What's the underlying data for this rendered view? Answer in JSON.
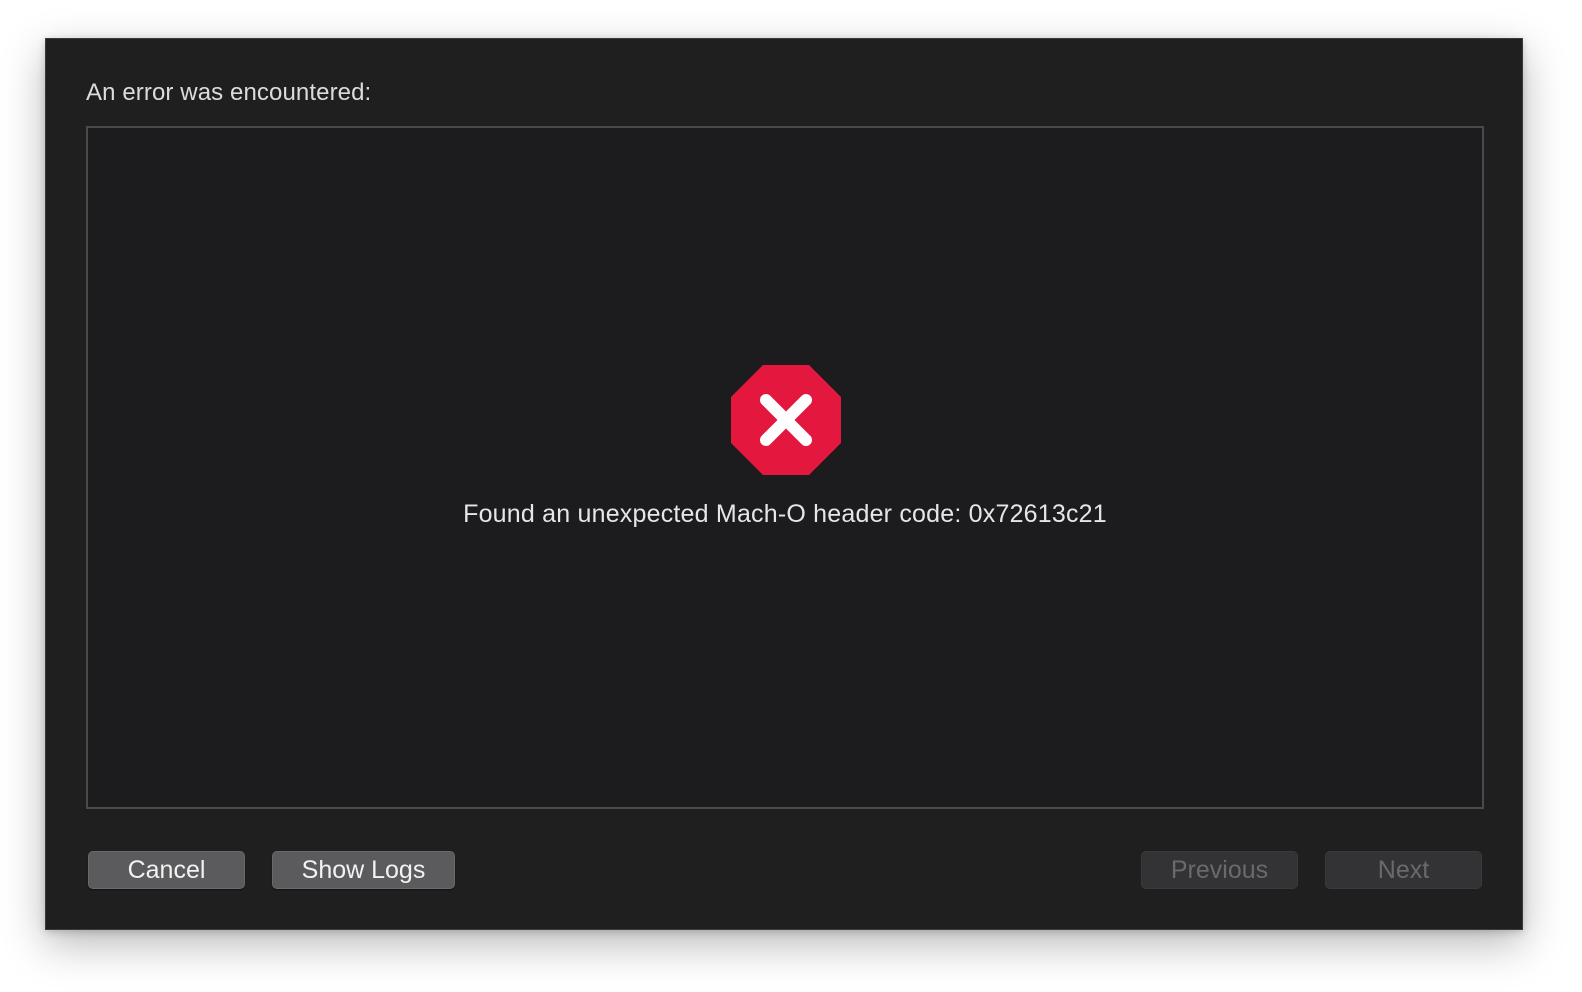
{
  "dialog": {
    "heading": "An error was encountered:",
    "error_message": "Found an unexpected Mach-O header code: 0x72613c21",
    "icon": "error-stop-icon",
    "icon_color": "#e4173f"
  },
  "buttons": {
    "cancel": "Cancel",
    "show_logs": "Show Logs",
    "previous": "Previous",
    "next": "Next"
  }
}
